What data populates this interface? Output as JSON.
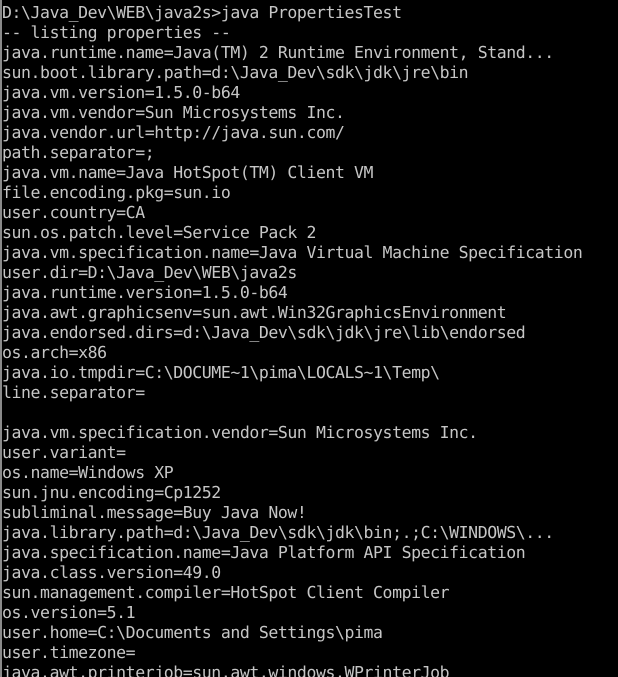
{
  "window": {
    "type": "windows-command-prompt",
    "background_color": "#000000",
    "text_color": "#c6c6c6",
    "columns": 61,
    "visible_rows": 34
  },
  "console": {
    "prompt_path": "D:\\Java_Dev\\WEB\\java2s",
    "prompt_symbol": ">",
    "command": "java PropertiesTest",
    "prompt_line": "D:\\Java_Dev\\WEB\\java2s>java PropertiesTest",
    "banner": "-- listing properties --",
    "lines": [
      "D:\\Java_Dev\\WEB\\java2s>java PropertiesTest",
      "-- listing properties --",
      "java.runtime.name=Java(TM) 2 Runtime Environment, Stand...",
      "sun.boot.library.path=d:\\Java_Dev\\sdk\\jdk\\jre\\bin",
      "java.vm.version=1.5.0-b64",
      "java.vm.vendor=Sun Microsystems Inc.",
      "java.vendor.url=http://java.sun.com/",
      "path.separator=;",
      "java.vm.name=Java HotSpot(TM) Client VM",
      "file.encoding.pkg=sun.io",
      "user.country=CA",
      "sun.os.patch.level=Service Pack 2",
      "java.vm.specification.name=Java Virtual Machine Specification",
      "user.dir=D:\\Java_Dev\\WEB\\java2s",
      "java.runtime.version=1.5.0-b64",
      "java.awt.graphicsenv=sun.awt.Win32GraphicsEnvironment",
      "java.endorsed.dirs=d:\\Java_Dev\\sdk\\jdk\\jre\\lib\\endorsed",
      "os.arch=x86",
      "java.io.tmpdir=C:\\DOCUME~1\\pima\\LOCALS~1\\Temp\\",
      "line.separator=",
      "",
      "java.vm.specification.vendor=Sun Microsystems Inc.",
      "user.variant=",
      "os.name=Windows XP",
      "sun.jnu.encoding=Cp1252",
      "subliminal.message=Buy Java Now!",
      "java.library.path=d:\\Java_Dev\\sdk\\jdk\\bin;.;C:\\WINDOWS\\...",
      "java.specification.name=Java Platform API Specification",
      "java.class.version=49.0",
      "sun.management.compiler=HotSpot Client Compiler",
      "os.version=5.1",
      "user.home=C:\\Documents and Settings\\pima",
      "user.timezone=",
      "java.awt.printerjob=sun.awt.windows.WPrinterJob"
    ]
  }
}
